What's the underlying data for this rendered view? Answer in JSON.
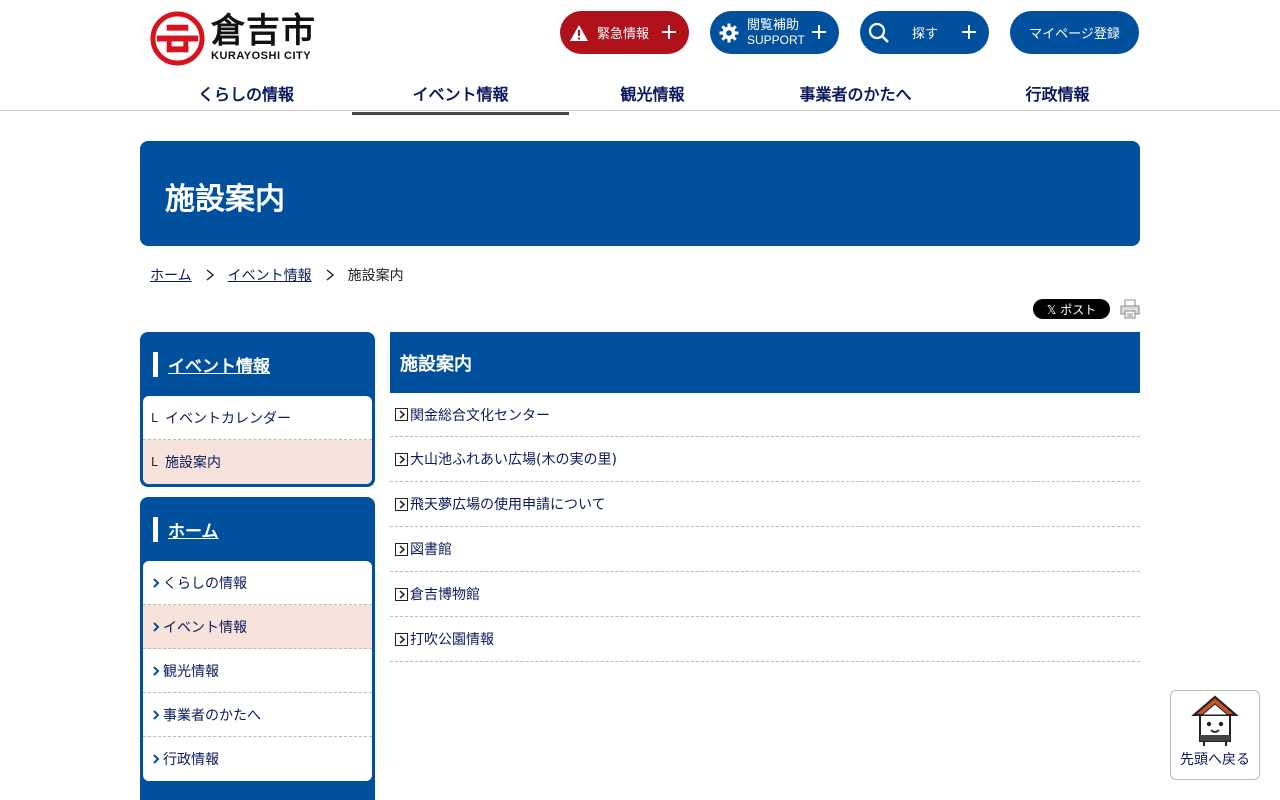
{
  "header": {
    "logo_jp": "倉吉市",
    "logo_en": "KURAYOSHI CITY",
    "emergency_label": "緊急情報",
    "support_label_jp": "閲覧補助",
    "support_label_en": "SUPPORT",
    "search_label": "探す",
    "mypage_label": "マイページ登録",
    "colors": {
      "brand": "#00509e",
      "emergency": "#b0121b"
    }
  },
  "gnav": [
    {
      "label": "くらしの情報"
    },
    {
      "label": "イベント情報"
    },
    {
      "label": "観光情報"
    },
    {
      "label": "事業者のかたへ"
    },
    {
      "label": "行政情報"
    }
  ],
  "page_title": "施設案内",
  "breadcrumb": [
    {
      "label": "ホーム"
    },
    {
      "label": "イベント情報"
    },
    {
      "label": "施設案内"
    }
  ],
  "share": {
    "post_label": "𝕏 ポスト"
  },
  "sidebar": {
    "box1": {
      "title": "イベント情報",
      "items": [
        {
          "marker": "L",
          "label": "イベントカレンダー"
        },
        {
          "marker": "L",
          "label": "施設案内"
        }
      ]
    },
    "box2": {
      "title": "ホーム",
      "items": [
        {
          "label": "くらしの情報"
        },
        {
          "label": "イベント情報"
        },
        {
          "label": "観光情報"
        },
        {
          "label": "事業者のかたへ"
        },
        {
          "label": "行政情報"
        }
      ]
    }
  },
  "main": {
    "heading": "施設案内",
    "links": [
      {
        "label": "関金総合文化センター"
      },
      {
        "label": "大山池ふれあい広場(木の実の里)"
      },
      {
        "label": "飛天夢広場の使用申請について"
      },
      {
        "label": "図書館"
      },
      {
        "label": "倉吉博物館"
      },
      {
        "label": "打吹公園情報"
      }
    ]
  },
  "totop_label": "先頭へ戻る"
}
